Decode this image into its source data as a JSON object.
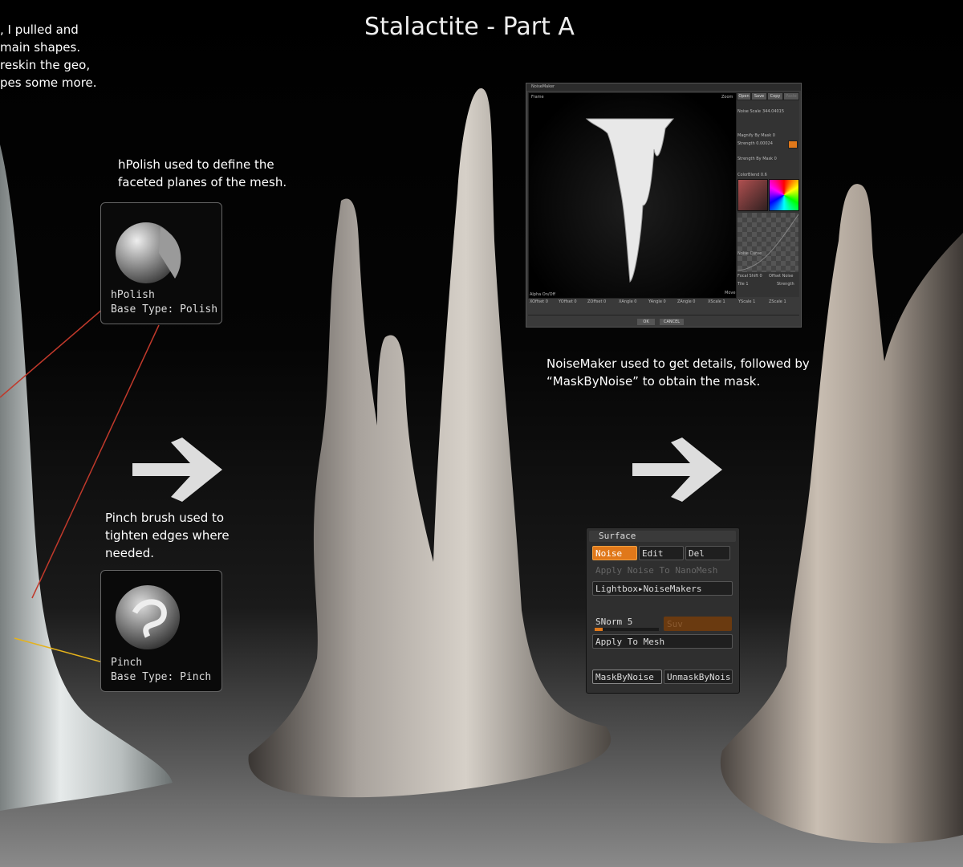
{
  "title": "Stalactite - Part A",
  "intro_lines": [
    ", I pulled and",
    "main shapes.",
    "reskin the geo,",
    "pes some more."
  ],
  "hpolish_note": [
    "hPolish used to define the",
    "faceted planes of the mesh."
  ],
  "hpolish_brush": {
    "name": "hPolish",
    "base_type": "Base Type: Polish"
  },
  "pinch_note": [
    "Pinch brush used to",
    "tighten edges where",
    "needed."
  ],
  "pinch_brush": {
    "name": "Pinch",
    "base_type": "Base Type: Pinch"
  },
  "noisemaker_note": [
    "NoiseMaker used to get details, followed by",
    "“MaskByNoise” to obtain the mask."
  ],
  "noisemaker_window": {
    "title": "NoiseMaker",
    "frame_label": "Frame",
    "zoom_label": "Zoom",
    "move_label": "Move",
    "alpha_label": "Alpha On/Off",
    "buttons": [
      "Open",
      "Save",
      "Copy",
      "Paste"
    ],
    "noise_scale_label": "Noise Scale",
    "noise_scale_value": "344.04015",
    "magnify_label": "Magnify By Mask 0",
    "strength_label": "Strength 0.00024",
    "strength_mask_label": "Strength By Mask 0",
    "colorblend_label": "ColorBlend 0.6",
    "noise_curve_label": "Noise Curve",
    "focal_shift_label": "Focal Shift 0",
    "offset_noise_label": "Offset Noise",
    "tile_label": "Tile 1",
    "strength2_label": "Strength",
    "offset_labels": [
      "XOffset 0",
      "YOffset 0",
      "ZOffset 0",
      "XAngle 0",
      "YAngle 0",
      "ZAngle 0",
      "XScale 1",
      "YScale 1",
      "ZScale 1"
    ],
    "ok_label": "OK",
    "cancel_label": "CANCEL"
  },
  "surface_panel": {
    "header": "Surface",
    "noise_btn": "Noise",
    "edit_btn": "Edit",
    "del_btn": "Del",
    "apply_nano": "Apply Noise To NanoMesh",
    "lightbox_btn": "Lightbox",
    "noisemakers_btn": "NoiseMakers",
    "snorm_label": "SNorm 5",
    "snorm_value": 0.12,
    "suv_label": "Suv",
    "apply_mesh": "Apply To Mesh",
    "mask_btn": "MaskByNoise",
    "unmask_btn": "UnmaskByNois"
  },
  "colors": {
    "accent": "#e0781a",
    "red_line": "#c0392b",
    "yellow_line": "#e5b21c"
  }
}
